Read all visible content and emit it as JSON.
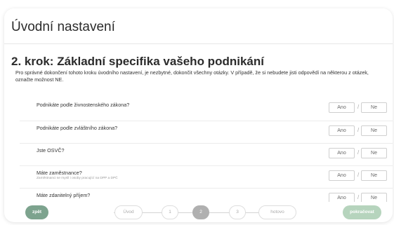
{
  "page": {
    "title": "Úvodní nastavení"
  },
  "step": {
    "heading": "2. krok: Základní specifika vašeho podnikání",
    "intro": "Pro správné dokončení tohoto kroku úvodního nastavení, je nezbytné, dokončit všechny otázky. V případě, že si nebudete jisti odpovědí na některou z otázek, označte možnost NE."
  },
  "questions": [
    {
      "text": "Podnikáte podle živnostenského zákona?",
      "note": ""
    },
    {
      "text": "Podnikáte podle zvláštního zákona?",
      "note": ""
    },
    {
      "text": "Jste OSVČ?",
      "note": ""
    },
    {
      "text": "Máte zaměstnance?",
      "note": "Zaměstnanci se myslí i osoby pracující na DPP a DPČ"
    },
    {
      "text": "Máte zdanitelný příjem?",
      "note": ""
    }
  ],
  "answer": {
    "yes": "Ano",
    "no": "Ne",
    "sep": "/"
  },
  "footer": {
    "back": "zpět",
    "next": "pokračovat",
    "steps": [
      "Úvod",
      "1",
      "2",
      "3",
      "hotovo"
    ],
    "active_step": "2"
  }
}
